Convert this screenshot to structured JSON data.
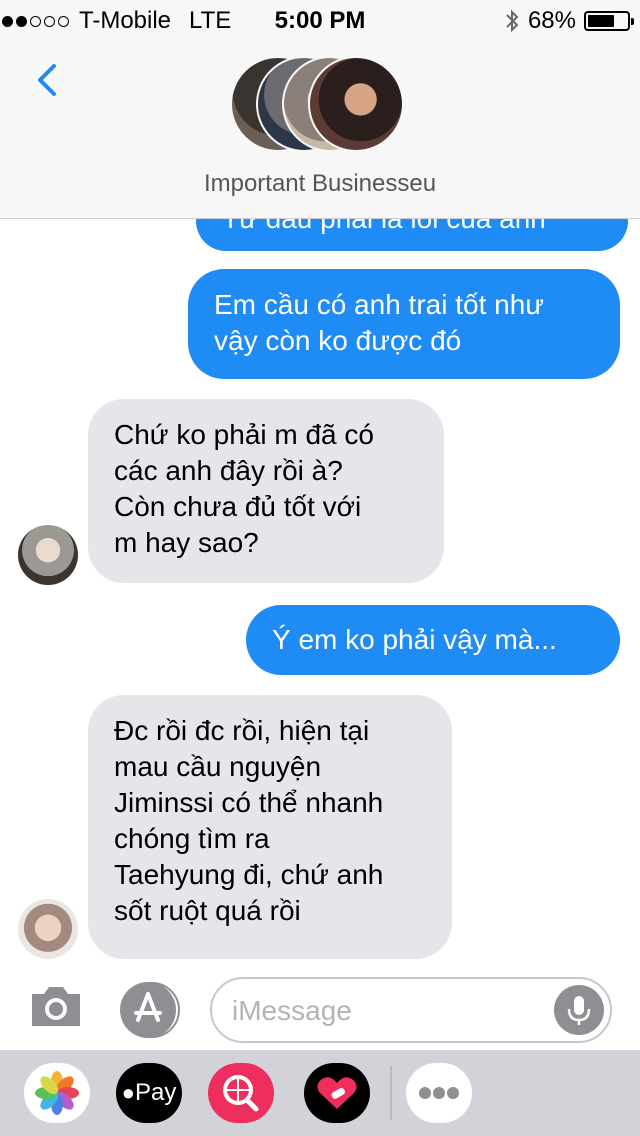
{
  "status_bar": {
    "carrier": "T-Mobile",
    "network": "LTE",
    "time": "5:00 PM",
    "battery": "68%",
    "battery_level": 0.68
  },
  "conversation": {
    "title": "Important Businesseu"
  },
  "messages": [
    {
      "direction": "outgoing",
      "text": "Từ đâu phải là lỗi của anh"
    },
    {
      "direction": "outgoing",
      "lines": [
        "Em cầu có anh trai tốt như",
        "vậy còn ko được đó"
      ]
    },
    {
      "direction": "incoming",
      "lines": [
        "Chứ ko phải m đã có",
        "các anh đây rồi à?",
        "Còn chưa đủ tốt với",
        "m hay sao?"
      ]
    },
    {
      "direction": "outgoing",
      "lines": [
        "Ý em ko phải vậy mà..."
      ]
    },
    {
      "direction": "incoming",
      "lines": [
        "Đc rồi đc rồi, hiện tại",
        "mau cầu nguyện",
        "Jiminssi có thể nhanh",
        "chóng tìm ra",
        "Taehyung đi, chứ anh",
        "sốt ruột quá rồi"
      ]
    }
  ],
  "input": {
    "placeholder": "iMessage"
  },
  "apps": {
    "apple_pay_label": "Pay",
    "icons": [
      "photos-icon",
      "apple-pay-icon",
      "web-search-icon",
      "heart-stickers-icon",
      "more-icon"
    ]
  },
  "colors": {
    "accent": "#1f8bf5",
    "incoming_bubble": "#e5e5ea",
    "header_bg": "#f7f7f7",
    "drawer_bg": "#d1d3d9"
  }
}
